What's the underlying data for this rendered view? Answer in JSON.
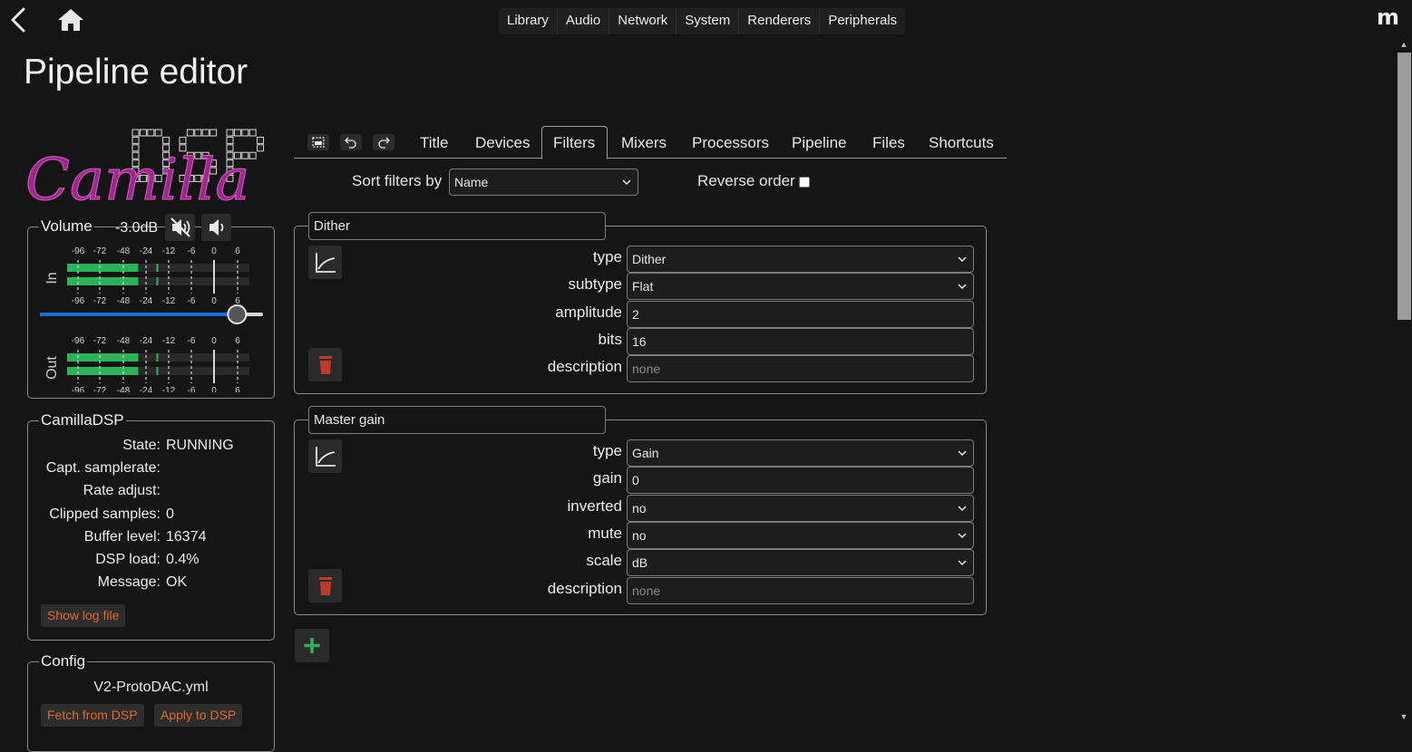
{
  "topnav": [
    "Library",
    "Audio",
    "Network",
    "System",
    "Renderers",
    "Peripherals"
  ],
  "brand_mark": "m",
  "page_title": "Pipeline editor",
  "logo": {
    "script": "Camilla",
    "block": "DSP"
  },
  "volume": {
    "label": "Volume",
    "value": "-3.0dB",
    "in_label": "In",
    "out_label": "Out",
    "scale": [
      "-96",
      "-72",
      "-48",
      "-24",
      "-12",
      "-6",
      "0",
      "6"
    ],
    "slider_fraction": 0.89,
    "in_levels": [
      0.39,
      0.39
    ],
    "out_levels": [
      0.39,
      0.39
    ]
  },
  "camilladsp": {
    "title": "CamillaDSP",
    "rows": [
      {
        "key": "State:",
        "value": "RUNNING"
      },
      {
        "key": "Capt. samplerate:",
        "value": ""
      },
      {
        "key": "Rate adjust:",
        "value": ""
      },
      {
        "key": "Clipped samples:",
        "value": "0"
      },
      {
        "key": "Buffer level:",
        "value": "16374"
      },
      {
        "key": "DSP load:",
        "value": "0.4%"
      },
      {
        "key": "Message:",
        "value": "OK"
      }
    ],
    "log_button": "Show log file"
  },
  "config": {
    "title": "Config",
    "filename": "V2-ProtoDAC.yml",
    "fetch_button": "Fetch from DSP",
    "apply_button": "Apply to DSP"
  },
  "tabs": [
    "Title",
    "Devices",
    "Filters",
    "Mixers",
    "Processors",
    "Pipeline",
    "Files",
    "Shortcuts"
  ],
  "active_tab": "Filters",
  "sort": {
    "label": "Sort filters by",
    "value": "Name",
    "reverse_label": "Reverse order"
  },
  "filters": [
    {
      "name": "Dither",
      "fields": [
        {
          "label": "type",
          "kind": "select",
          "value": "Dither"
        },
        {
          "label": "subtype",
          "kind": "select",
          "value": "Flat"
        },
        {
          "label": "amplitude",
          "kind": "input",
          "value": "2"
        },
        {
          "label": "bits",
          "kind": "input",
          "value": "16"
        },
        {
          "label": "description",
          "kind": "input",
          "value": "",
          "placeholder": "none"
        }
      ]
    },
    {
      "name": "Master gain",
      "fields": [
        {
          "label": "type",
          "kind": "select",
          "value": "Gain"
        },
        {
          "label": "gain",
          "kind": "input",
          "value": "0"
        },
        {
          "label": "inverted",
          "kind": "select",
          "value": "no"
        },
        {
          "label": "mute",
          "kind": "select",
          "value": "no"
        },
        {
          "label": "scale",
          "kind": "select",
          "value": "dB"
        },
        {
          "label": "description",
          "kind": "input",
          "value": "",
          "placeholder": "none"
        }
      ]
    }
  ],
  "colors": {
    "accent_orange": "#e06a2a",
    "meter_green": "#2bb35a",
    "delete_red": "#c0392b",
    "add_green": "#2bb35a",
    "logo_purple": "#a0258f"
  }
}
